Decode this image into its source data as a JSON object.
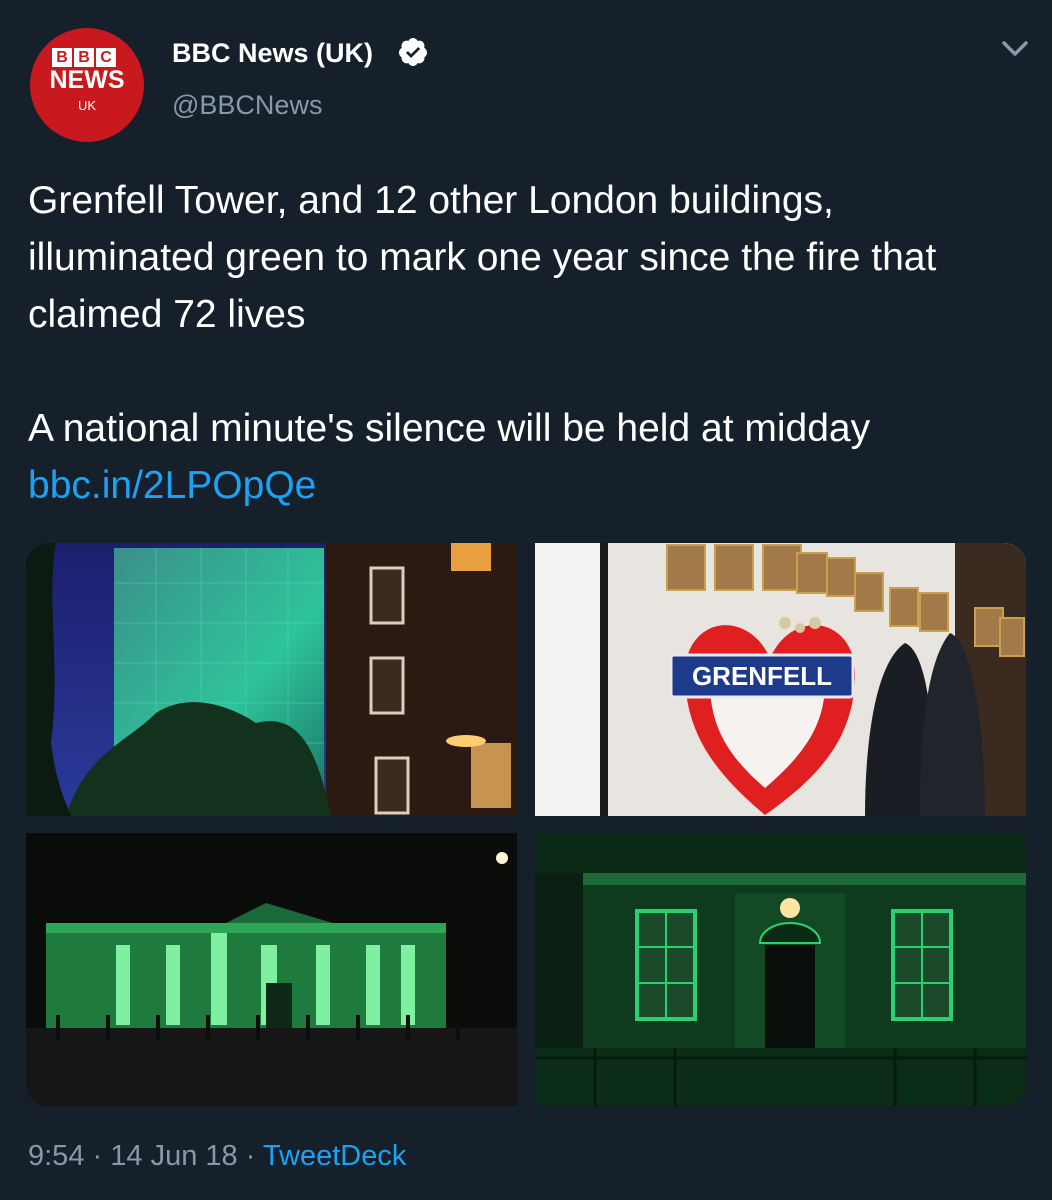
{
  "author": {
    "name": "BBC News (UK)",
    "handle": "@BBCNews",
    "verified": true,
    "avatar": {
      "logo_letters": [
        "B",
        "B",
        "C"
      ],
      "word": "NEWS",
      "region": "UK",
      "color": "#c81a1e"
    }
  },
  "tweet": {
    "text_paragraph_1": "Grenfell Tower, and 12 other London buildings, illuminated green to mark one year since the fire that claimed 72 lives",
    "text_paragraph_2": "A national minute's silence will be held at midday",
    "link": "bbc.in/2LPOpQe"
  },
  "media": {
    "tile_2_sign": "GRENFELL"
  },
  "meta": {
    "time": "9:54",
    "separator": "·",
    "date": "14 Jun 18",
    "source": "TweetDeck"
  },
  "colors": {
    "background": "#15202b",
    "link": "#1da1f2",
    "secondary_text": "#8899a6",
    "verified": "#ffffff"
  }
}
